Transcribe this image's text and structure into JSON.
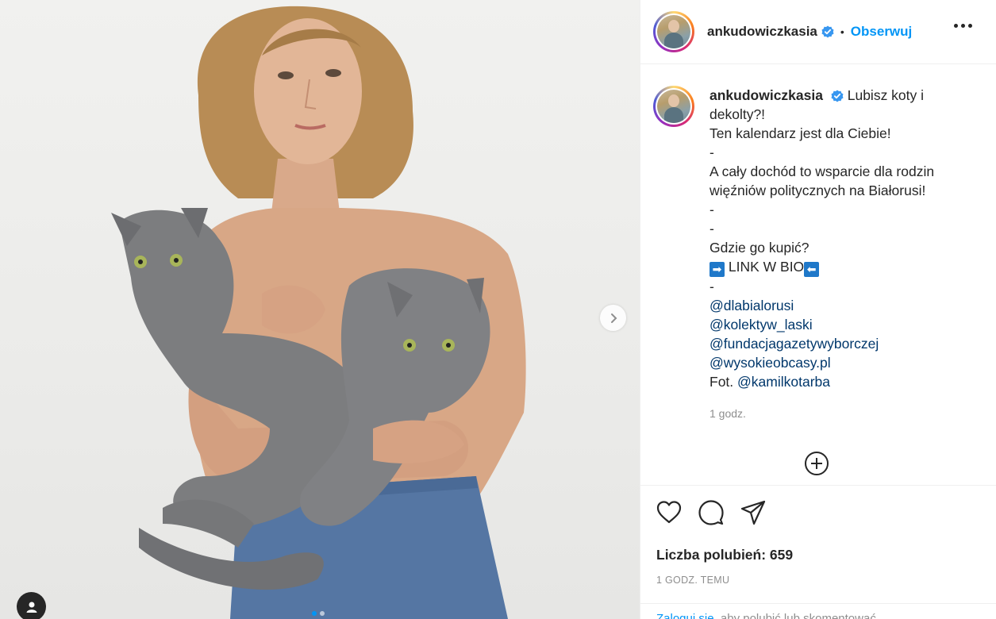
{
  "post": {
    "author": "ankudowiczkasia",
    "separator": "•",
    "follow_label": "Obserwuj",
    "caption_lines": [
      "dekolty?!",
      "Ten kalendarz jest dla Ciebie!",
      "-",
      "A cały dochód to wsparcie dla rodzin",
      "więźniów politycznych na Białorusi!",
      "-",
      "-",
      "Gdzie go kupić?"
    ],
    "caption_first": "Lubisz koty i",
    "link_in_bio": "LINK W BIO",
    "arrow_right": "➡",
    "arrow_left": "⬅",
    "dash": "-",
    "mentions": [
      "@dlabialorusi",
      "@kolektyw_laski",
      "@fundacjagazetywyborczej",
      "@wysokieobcasy.pl"
    ],
    "photo_prefix": "Fot.",
    "photo_mention": "@kamilkotarba",
    "caption_time": "1 godz.",
    "likes_label": "Liczba polubień: 659",
    "time_ago": "1 GODZ. TEMU",
    "login_link": "Zaloguj się",
    "login_text": ", aby polubić lub skomentować"
  },
  "carousel": {
    "total": 2,
    "active": 1
  },
  "colors": {
    "link": "#00376b",
    "follow": "#0095f6",
    "verified": "#3897f0",
    "muted": "#8e8e8e"
  },
  "icons": [
    "verified-badge-icon",
    "more-options-icon",
    "chevron-right-icon",
    "user-tag-icon",
    "add-comment-icon",
    "heart-icon",
    "comment-icon",
    "share-icon"
  ]
}
